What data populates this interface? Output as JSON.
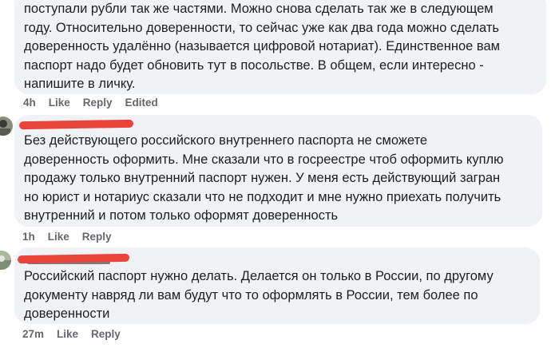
{
  "comments": [
    {
      "lines": [
        "поступали рубли так же частями. Можно снова сделать так же в следующем",
        "году. Относительно доверенности, то сейчас уже как два года можно сделать",
        "доверенность удалённо (называется цифровой нотариат). Единственное вам",
        "паспорт надо будет обновить тут в посольстве. В общем, если интересно -",
        "напишите в личку."
      ],
      "time": "4h",
      "like": "Like",
      "reply": "Reply",
      "edited": "Edited"
    },
    {
      "lines": [
        "Без действующего российского внутреннего паспорта не сможете",
        "доверенность оформить. Мне сказали что в госреестре чтоб оформить куплю",
        "продажу только внутренний паспорт нужен. У меня есть действующий загран",
        "но юрист и нотариус сказали что не подходит и мне нужно приехать получить",
        "внутренний и потом только оформят доверенность"
      ],
      "time": "1h",
      "like": "Like",
      "reply": "Reply"
    },
    {
      "lines": [
        "Российский паспорт нужно делать. Делается он только в России, по другому",
        "документу навряд ли вам будут что то оформлять в России, тем более по",
        "доверенности"
      ],
      "time": "27m",
      "like": "Like",
      "reply": "Reply"
    }
  ],
  "colors": {
    "bubble": "#f0f2f5",
    "text": "#1c1e21",
    "meta": "#65676b",
    "redaction": "#e8443a"
  }
}
